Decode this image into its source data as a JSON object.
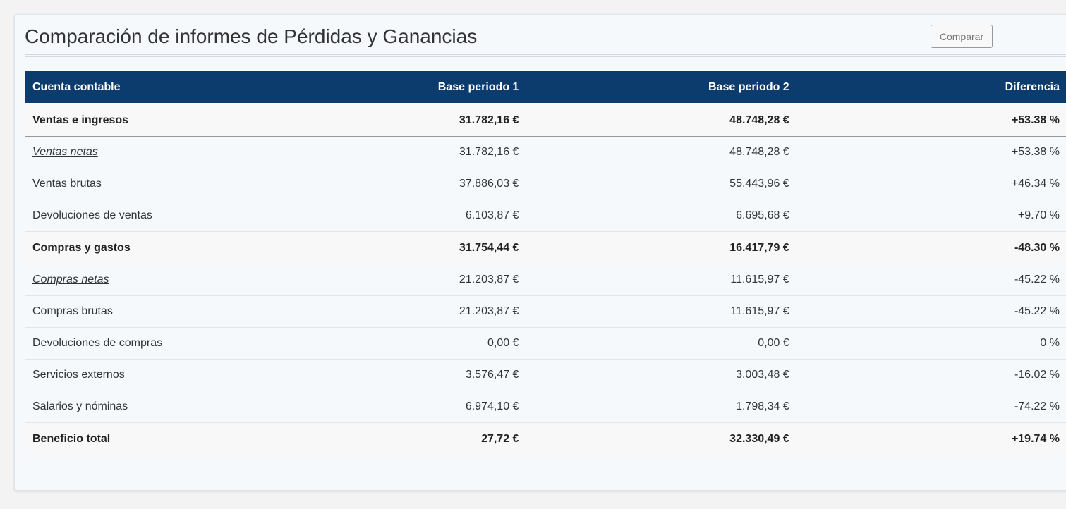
{
  "header": {
    "title": "Comparación de informes de Pérdidas y Ganancias",
    "compare_label": "Comparar"
  },
  "table": {
    "columns": [
      "Cuenta contable",
      "Base periodo 1",
      "Base periodo 2",
      "Diferencia"
    ],
    "rows": [
      {
        "type": "group",
        "account": "Ventas e ingresos",
        "p1": "31.782,16 €",
        "p2": "48.748,28 €",
        "diff": "+53.38 %"
      },
      {
        "type": "sub",
        "account": "Ventas netas",
        "p1": "31.782,16 €",
        "p2": "48.748,28 €",
        "diff": "+53.38 %"
      },
      {
        "type": "item",
        "account": "Ventas brutas",
        "p1": "37.886,03 €",
        "p2": "55.443,96 €",
        "diff": "+46.34 %"
      },
      {
        "type": "item",
        "account": "Devoluciones de ventas",
        "p1": "6.103,87 €",
        "p2": "6.695,68 €",
        "diff": "+9.70 %"
      },
      {
        "type": "group",
        "account": "Compras y gastos",
        "p1": "31.754,44 €",
        "p2": "16.417,79 €",
        "diff": "-48.30 %"
      },
      {
        "type": "sub",
        "account": "Compras netas",
        "p1": "21.203,87 €",
        "p2": "11.615,97 €",
        "diff": "-45.22 %"
      },
      {
        "type": "item",
        "account": "Compras brutas",
        "p1": "21.203,87 €",
        "p2": "11.615,97 €",
        "diff": "-45.22 %"
      },
      {
        "type": "item",
        "account": "Devoluciones de compras",
        "p1": "0,00 €",
        "p2": "0,00 €",
        "diff": "0 %"
      },
      {
        "type": "item",
        "account": "Servicios externos",
        "p1": "3.576,47 €",
        "p2": "3.003,48 €",
        "diff": "-16.02 %"
      },
      {
        "type": "item",
        "account": "Salarios y nóminas",
        "p1": "6.974,10 €",
        "p2": "1.798,34 €",
        "diff": "-74.22 %"
      },
      {
        "type": "group",
        "account": "Beneficio total",
        "p1": "27,72 €",
        "p2": "32.330,49 €",
        "diff": "+19.74 %"
      }
    ]
  },
  "colors": {
    "header_bg": "#0c3b6d",
    "panel_bg": "#f5f9fc",
    "page_bg": "#f3f3f3"
  }
}
